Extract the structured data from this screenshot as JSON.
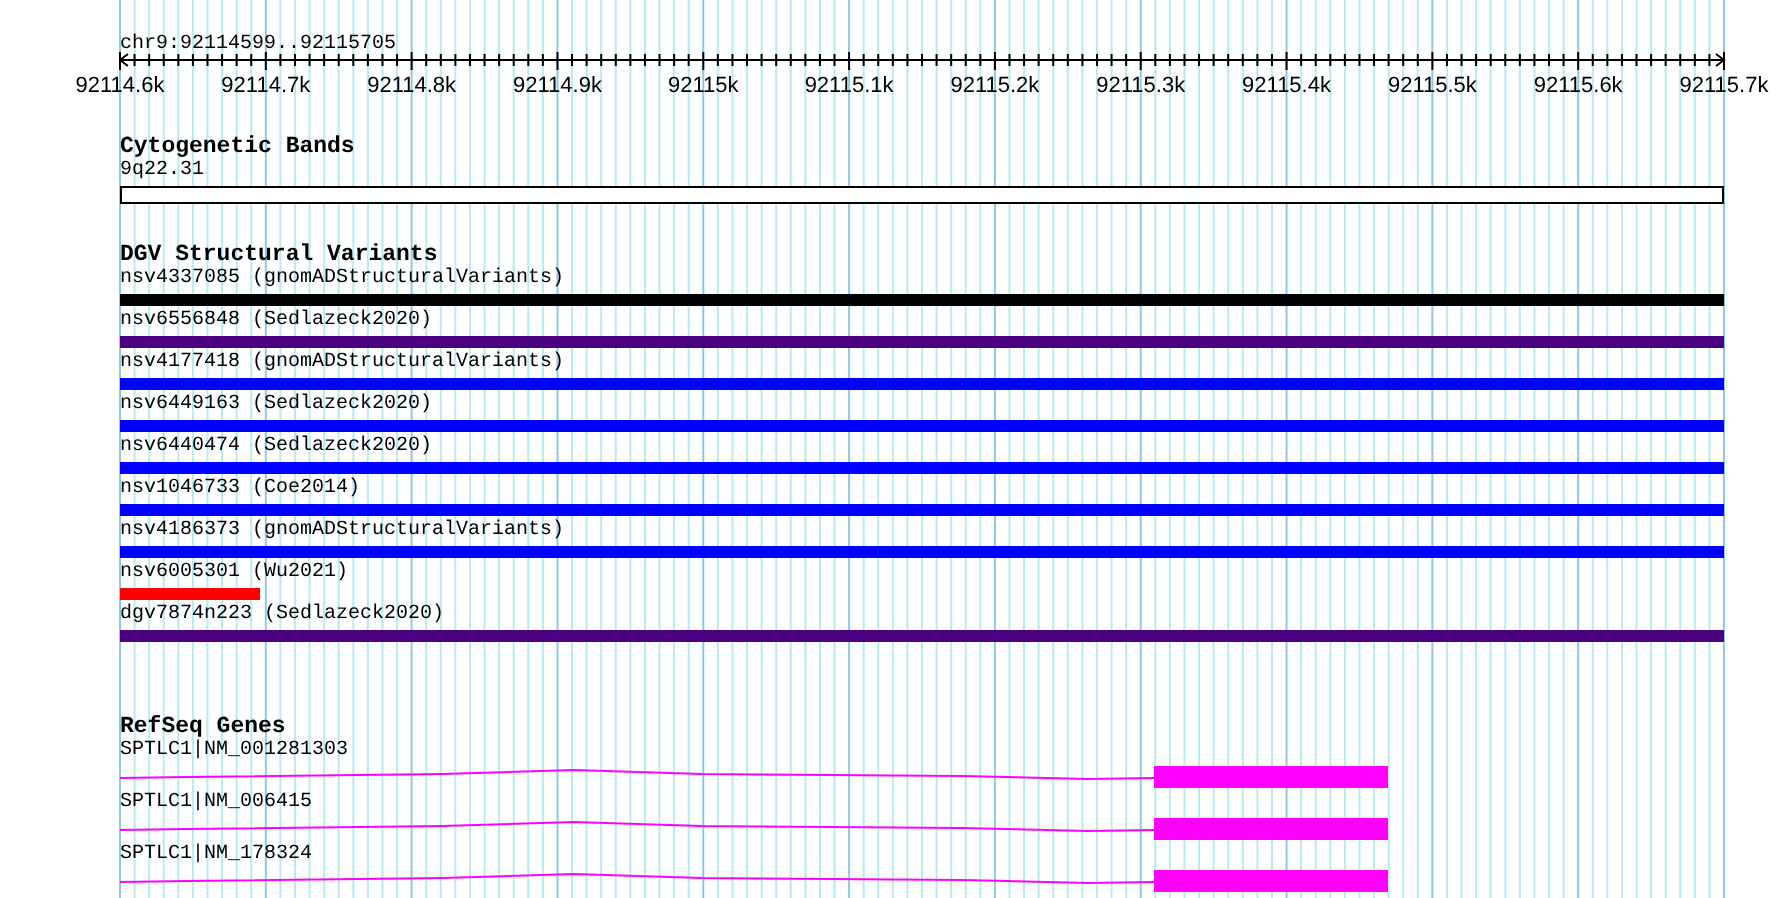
{
  "ruler": {
    "title": "chr9:92114599..92115705",
    "ticks": [
      "92114.6k",
      "92114.7k",
      "92114.8k",
      "92114.9k",
      "92115k",
      "92115.1k",
      "92115.2k",
      "92115.3k",
      "92115.4k",
      "92115.5k",
      "92115.6k",
      "92115.7k"
    ]
  },
  "tracks": [
    {
      "kind": "bands",
      "title": "Cytogenetic Bands",
      "features": [
        {
          "label": "9q22.31"
        }
      ]
    },
    {
      "kind": "variants",
      "title": "DGV Structural Variants",
      "features": [
        {
          "label": "nsv4337085 (gnomADStructuralVariants)",
          "color": "#000000",
          "spans_view": true
        },
        {
          "label": "nsv6556848 (Sedlazeck2020)",
          "color": "#4b0082",
          "spans_view": true
        },
        {
          "label": "nsv4177418 (gnomADStructuralVariants)",
          "color": "#0000ff",
          "spans_view": true
        },
        {
          "label": "nsv6449163 (Sedlazeck2020)",
          "color": "#0000ff",
          "spans_view": true
        },
        {
          "label": "nsv6440474 (Sedlazeck2020)",
          "color": "#0000ff",
          "spans_view": true
        },
        {
          "label": "nsv1046733 (Coe2014)",
          "color": "#0000ff",
          "spans_view": true
        },
        {
          "label": "nsv4186373 (gnomADStructuralVariants)",
          "color": "#0000ff",
          "spans_view": true
        },
        {
          "label": "nsv6005301 (Wu2021)",
          "color": "#ff0000",
          "spans_view": false
        },
        {
          "label": "dgv7874n223 (Sedlazeck2020)",
          "color": "#4b0082",
          "spans_view": true
        }
      ]
    },
    {
      "kind": "genes",
      "title": "RefSeq Genes",
      "features": [
        {
          "label": "SPTLC1|NM_001281303"
        },
        {
          "label": "SPTLC1|NM_006415"
        },
        {
          "label": "SPTLC1|NM_178324"
        }
      ]
    }
  ]
}
